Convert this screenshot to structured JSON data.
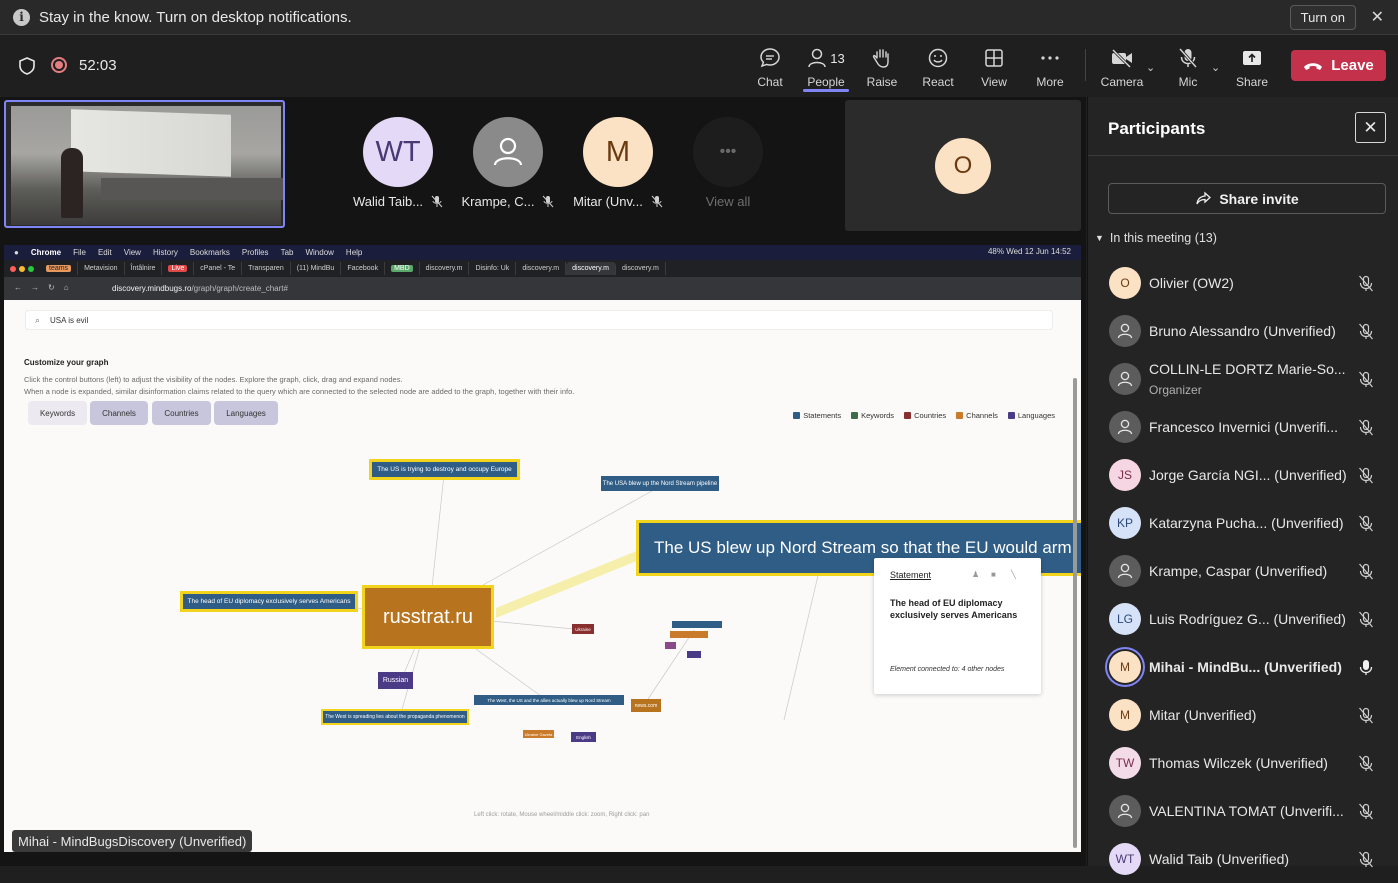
{
  "notification": {
    "message": "Stay in the know. Turn on desktop notifications.",
    "turn_on": "Turn on",
    "close": "✕"
  },
  "toolbar": {
    "timer": "52:03",
    "chat": "Chat",
    "people": "People",
    "people_count": "13",
    "raise": "Raise",
    "react": "React",
    "view": "View",
    "more": "More",
    "camera": "Camera",
    "mic": "Mic",
    "share": "Share",
    "leave": "Leave",
    "colors": {
      "leave": "#c4314b",
      "accent": "#7f85f5"
    }
  },
  "stage": {
    "tiles": [
      {
        "initials": "WT",
        "name": "Walid Taib...",
        "bg": "#e4d9f6",
        "fg": "#4a3a74"
      },
      {
        "initials": "",
        "name": "Krampe, C...",
        "bg": "#8a8a8a",
        "fg": "#fff"
      },
      {
        "initials": "M",
        "name": "Mitar (Unv...",
        "bg": "#fbe2c4",
        "fg": "#6b3a10"
      }
    ],
    "view_all": "View all",
    "view_all_icon": "•••",
    "speaker_initial": "O",
    "presenter_name": "Mihai - MindBugsDiscovery (Unverified)"
  },
  "shared_screen": {
    "mac_menu": [
      "Chrome",
      "File",
      "Edit",
      "View",
      "History",
      "Bookmarks",
      "Profiles",
      "Tab",
      "Window",
      "Help"
    ],
    "mac_status": "48%   Wed 12 Jun  14:52",
    "tabs": [
      "teams",
      "Metavision",
      "Întâlnire",
      "Live",
      "cPanel - Te",
      "Transparen",
      "(11) MindBu",
      "Facebook",
      "MBD",
      "discovery.m",
      "Disinfo: Uk",
      "discovery.m",
      "discovery.m",
      "discovery.m"
    ],
    "url_host": "discovery.mindbugs.ro",
    "url_path": "/graph/graph/create_chart#",
    "search_value": "USA is evil",
    "customize_title": "Customize your graph",
    "customize_line1": "Click the control buttons (left) to adjust the visibility of the nodes. Explore the graph, click, drag and expand nodes.",
    "customize_line2": "When a node is expanded, similar disinformation claims related to the query which are connected to the selected node are added to the graph, together with their info.",
    "filters": [
      "Keywords",
      "Channels",
      "Countries",
      "Languages"
    ],
    "legend": [
      {
        "label": "Statements",
        "color": "#2f5d85"
      },
      {
        "label": "Keywords",
        "color": "#3e6b4a"
      },
      {
        "label": "Countries",
        "color": "#8a2f2f"
      },
      {
        "label": "Channels",
        "color": "#c97a2a"
      },
      {
        "label": "Languages",
        "color": "#4b3a86"
      }
    ],
    "nodes": {
      "n1": "The US is trying to destroy and occupy Europe",
      "n2": "The USA blew up the Nord Stream pipeline",
      "n3": "The US blew up Nord Stream so that the EU would arm",
      "n4": "The head of EU diplomacy exclusively serves Americans",
      "n5": "russtrat.ru",
      "n6": "Russian",
      "n7": "The West is spreading lies about the propaganda phenomenon",
      "n8": "The West, the US and the allies actually blew up Nord Stream",
      "n9": "Ukraine",
      "n10": "news.com",
      "n11": "Ukraine Gazeta",
      "n12": "English"
    },
    "popup": {
      "title": "Statement",
      "body": "The head of EU diplomacy exclusively serves Americans",
      "foot": "Element connected to: 4 other nodes"
    },
    "hint": "Left click: rotate, Mouse wheel/middle click: zoom, Right click: pan"
  },
  "panel": {
    "title": "Participants",
    "share_invite": "Share invite",
    "in_meeting": "In this meeting (13)",
    "participants": [
      {
        "initials": "O",
        "name": "Olivier (OW2)",
        "bg": "#fbe2c4",
        "fg": "#6b3a10",
        "generic": false,
        "mic_on": false
      },
      {
        "initials": "",
        "name": "Bruno Alessandro (Unverified)",
        "bg": "#5c5c5c",
        "fg": "#fff",
        "generic": true,
        "mic_on": false
      },
      {
        "initials": "",
        "name": "COLLIN-LE DORTZ Marie-So...",
        "sub": "Organizer",
        "bg": "#5c5c5c",
        "fg": "#fff",
        "generic": true,
        "mic_on": false
      },
      {
        "initials": "",
        "name": "Francesco Invernici (Unverifi...",
        "bg": "#5c5c5c",
        "fg": "#fff",
        "generic": true,
        "mic_on": false
      },
      {
        "initials": "JS",
        "name": "Jorge García NGI... (Unverified)",
        "bg": "#f6d6e2",
        "fg": "#7a2d4d",
        "generic": false,
        "mic_on": false
      },
      {
        "initials": "KP",
        "name": "Katarzyna Pucha... (Unverified)",
        "bg": "#d5e2f7",
        "fg": "#2d4a7a",
        "generic": false,
        "mic_on": false
      },
      {
        "initials": "",
        "name": "Krampe, Caspar (Unverified)",
        "bg": "#5c5c5c",
        "fg": "#fff",
        "generic": true,
        "mic_on": false
      },
      {
        "initials": "LG",
        "name": "Luis Rodríguez G... (Unverified)",
        "bg": "#d5e2f7",
        "fg": "#2d4a7a",
        "generic": false,
        "mic_on": false
      },
      {
        "initials": "M",
        "name": "Mihai - MindBu...  (Unverified)",
        "bg": "#fbe2c4",
        "fg": "#6b3a10",
        "generic": false,
        "mic_on": true,
        "speaking": true
      },
      {
        "initials": "M",
        "name": "Mitar (Unverified)",
        "bg": "#fbe2c4",
        "fg": "#6b3a10",
        "generic": false,
        "mic_on": false
      },
      {
        "initials": "TW",
        "name": "Thomas Wilczek (Unverified)",
        "bg": "#f3dbe8",
        "fg": "#7a2d4d",
        "generic": false,
        "mic_on": false
      },
      {
        "initials": "",
        "name": "VALENTINA TOMAT (Unverifi...",
        "bg": "#5c5c5c",
        "fg": "#fff",
        "generic": true,
        "mic_on": false
      },
      {
        "initials": "WT",
        "name": "Walid Taib (Unverified)",
        "bg": "#e4d9f6",
        "fg": "#4a3a74",
        "generic": false,
        "mic_on": false
      }
    ]
  }
}
